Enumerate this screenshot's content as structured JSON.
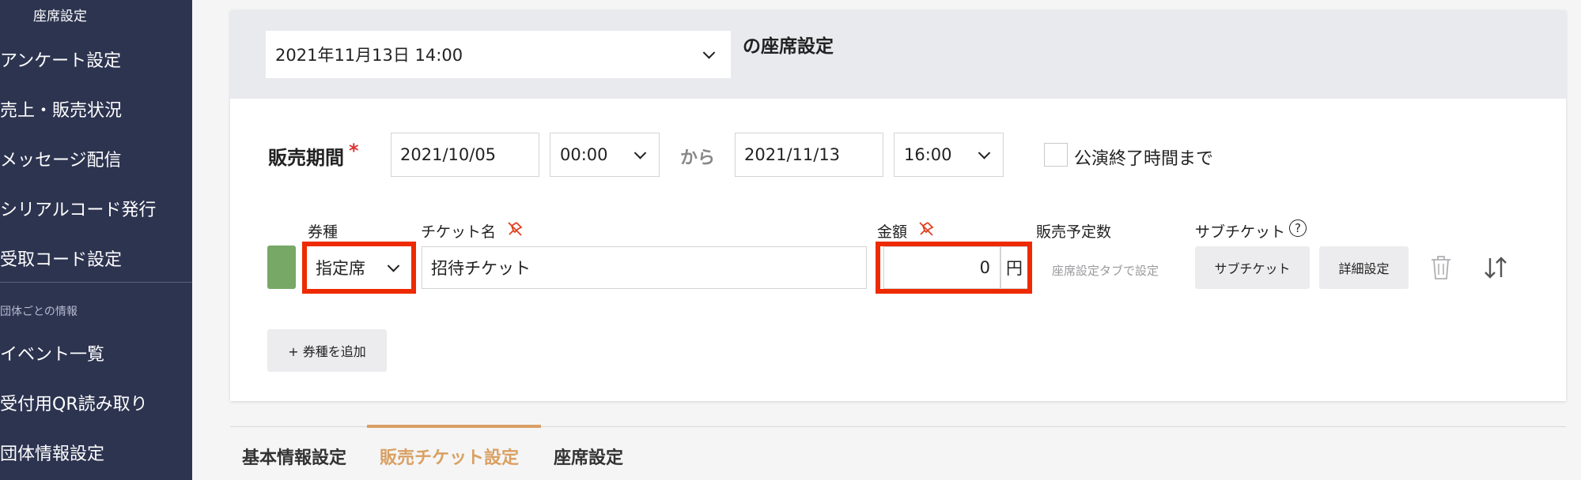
{
  "sidebar": {
    "sub_item": "座席設定",
    "items": [
      "アンケート設定",
      "売上・販売状況",
      "メッセージ配信",
      "シリアルコード発行",
      "受取コード設定"
    ],
    "section_title": "団体ごとの情報",
    "section_items": [
      "イベント一覧",
      "受付用QR読み取り",
      "団体情報設定"
    ]
  },
  "header": {
    "performance_select": "2021年11月13日 14:00",
    "title": "の座席設定"
  },
  "sale_period": {
    "label": "販売期間",
    "required_mark": "*",
    "start_date": "2021/10/05",
    "start_time": "00:00",
    "separator": "から",
    "end_date": "2021/11/13",
    "end_time": "16:00",
    "until_end_label": "公演終了時間まで"
  },
  "ticket_table": {
    "headers": {
      "type": "券種",
      "name": "チケット名",
      "price": "金額",
      "planned": "販売予定数",
      "sub_ticket": "サブチケット",
      "help": "?"
    },
    "row": {
      "color": "#77a866",
      "type": "指定席",
      "name": "招待チケット",
      "price": "0",
      "currency": "円",
      "planned_hint": "座席設定タブで設定",
      "sub_ticket_button": "サブチケット",
      "detail_button": "詳細設定"
    },
    "add_button": "+ 券種を追加"
  },
  "tabs": [
    "基本情報設定",
    "販売チケット設定",
    "座席設定"
  ],
  "active_tab": "販売チケット設定",
  "colors": {
    "sidebar": "#2d3450",
    "accent": "#d9a063",
    "highlight": "#ee2a00"
  }
}
